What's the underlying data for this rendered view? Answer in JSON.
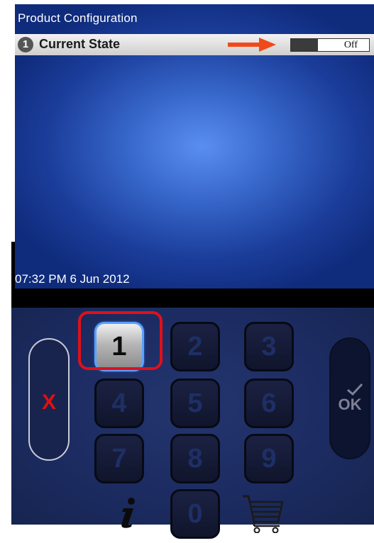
{
  "screen": {
    "title": "Product Configuration",
    "row": {
      "number": "1",
      "label": "Current State",
      "toggle_value": "Off"
    },
    "timestamp": "07:32 PM 6 Jun 2012"
  },
  "keypad": {
    "keys": [
      "1",
      "2",
      "3",
      "4",
      "5",
      "6",
      "7",
      "8",
      "9",
      "0"
    ],
    "selected_key": "1",
    "cancel_label": "X",
    "ok_label": "OK"
  },
  "icons": {
    "arrow": "arrow-right-icon",
    "info": "info-icon",
    "cart": "cart-icon",
    "check": "check-icon"
  },
  "colors": {
    "highlight": "#e0101a",
    "arrow": "#f04a1a",
    "cancel": "#e01010"
  }
}
